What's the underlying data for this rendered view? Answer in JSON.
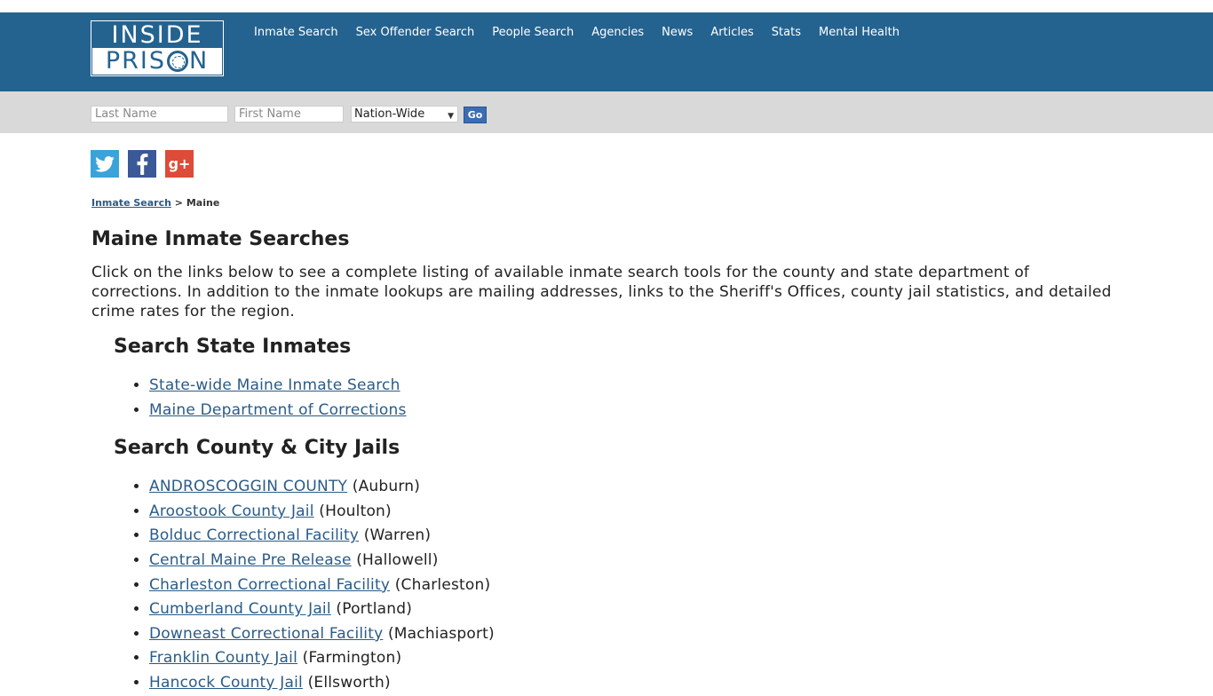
{
  "logo": {
    "top": "INSIDE",
    "bottom_pre": "PRIS",
    "bottom_post": "N"
  },
  "nav": [
    "Inmate Search",
    "Sex Offender Search",
    "People Search",
    "Agencies",
    "News",
    "Articles",
    "Stats",
    "Mental Health"
  ],
  "search": {
    "last_placeholder": "Last Name",
    "first_placeholder": "First Name",
    "scope_selected": "Nation-Wide",
    "go_label": "Go"
  },
  "social": {
    "twitter": "twitter-icon",
    "facebook": "facebook-icon",
    "google": "g+"
  },
  "breadcrumb": {
    "link": "Inmate Search",
    "sep": ">",
    "current": "Maine"
  },
  "page_title": "Maine Inmate Searches",
  "intro": "Click on the links below to see a complete listing of available inmate search tools for the county and state department of corrections. In addition to the inmate lookups are mailing addresses, links to the Sheriff's Offices, county jail statistics, and detailed crime rates for the region.",
  "state_section": {
    "heading": "Search State Inmates",
    "links": [
      "State-wide Maine Inmate Search",
      "Maine Department of Corrections"
    ]
  },
  "county_section": {
    "heading": "Search County & City Jails",
    "items": [
      {
        "name": "ANDROSCOGGIN COUNTY",
        "city": "(Auburn)"
      },
      {
        "name": "Aroostook County Jail",
        "city": "(Houlton)"
      },
      {
        "name": "Bolduc Correctional Facility",
        "city": "(Warren)"
      },
      {
        "name": "Central Maine Pre Release",
        "city": "(Hallowell)"
      },
      {
        "name": "Charleston Correctional Facility",
        "city": "(Charleston)"
      },
      {
        "name": "Cumberland County Jail",
        "city": "(Portland)"
      },
      {
        "name": "Downeast Correctional Facility",
        "city": "(Machiasport)"
      },
      {
        "name": "Franklin County Jail",
        "city": "(Farmington)"
      },
      {
        "name": "Hancock County Jail",
        "city": "(Ellsworth)"
      }
    ]
  }
}
